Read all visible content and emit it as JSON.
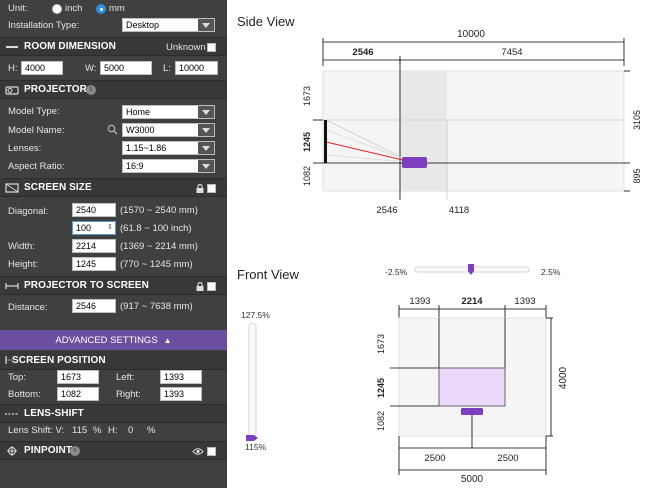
{
  "unit": {
    "label": "Unit:",
    "inch": "inch",
    "mm": "mm",
    "selected": "mm"
  },
  "installation": {
    "label": "Installation Type:",
    "value": "Desktop"
  },
  "room": {
    "title": "ROOM DIMENSION",
    "unknown_label": "Unknown",
    "h_label": "H:",
    "h": "4000",
    "w_label": "W:",
    "w": "5000",
    "l_label": "L:",
    "l": "10000"
  },
  "projector": {
    "title": "PROJECTOR",
    "model_type_label": "Model Type:",
    "model_type": "Home",
    "model_name_label": "Model Name:",
    "model_name": "W3000",
    "lenses_label": "Lenses:",
    "lenses": "1.15~1.86",
    "aspect_label": "Aspect Ratio:",
    "aspect": "16:9"
  },
  "screen_size": {
    "title": "SCREEN SIZE",
    "diagonal_label": "Diagonal:",
    "diagonal_mm": "2540",
    "diagonal_mm_range": "(1570 ~ 2540 mm)",
    "diagonal_inch": "100",
    "diagonal_inch_range": "(61.8 ~ 100 inch)",
    "width_label": "Width:",
    "width": "2214",
    "width_range": "(1369 ~ 2214 mm)",
    "height_label": "Height:",
    "height": "1245",
    "height_range": "(770 ~ 1245 mm)"
  },
  "projector_to_screen": {
    "title": "PROJECTOR TO SCREEN",
    "distance_label": "Distance:",
    "distance": "2546",
    "distance_range": "(917 ~ 7638 mm)"
  },
  "advanced": {
    "label": "ADVANCED SETTINGS"
  },
  "screen_position": {
    "title": "SCREEN POSITION",
    "top_label": "Top:",
    "top": "1673",
    "left_label": "Left:",
    "left": "1393",
    "bottom_label": "Bottom:",
    "bottom": "1082",
    "right_label": "Right:",
    "right": "1393"
  },
  "lens_shift": {
    "title": "LENS-SHIFT",
    "text_v": "Lens Shift: V:",
    "v": "115",
    "pct1": "%",
    "h_label": "H:",
    "h": "0",
    "pct2": "%"
  },
  "pinpoint": {
    "title": "PINPOINT"
  },
  "side_view": {
    "title": "Side View",
    "total": "10000",
    "left_seg": "2546",
    "right_seg": "7454",
    "top": "1673",
    "screen": "1245",
    "bottom": "1082",
    "right_top": "3105",
    "right_bottom": "895",
    "x1": "2546",
    "x2": "4118"
  },
  "front_view": {
    "title": "Front View",
    "shift_min": "-2.5%",
    "shift_max": "2.5%",
    "vshift_top": "127.5%",
    "vshift_bottom": "115%",
    "left": "1393",
    "width": "2214",
    "right": "1393",
    "top": "1673",
    "screen": "1245",
    "bottom": "1082",
    "height": "4000",
    "half_left": "2500",
    "half_right": "2500",
    "total": "5000"
  },
  "colors": {
    "panel": "#404040",
    "accent": "#6b4ea0",
    "projector": "#7b3fbf",
    "screen_fill": "#ead9fb",
    "radio_on": "#2f8fe0"
  }
}
